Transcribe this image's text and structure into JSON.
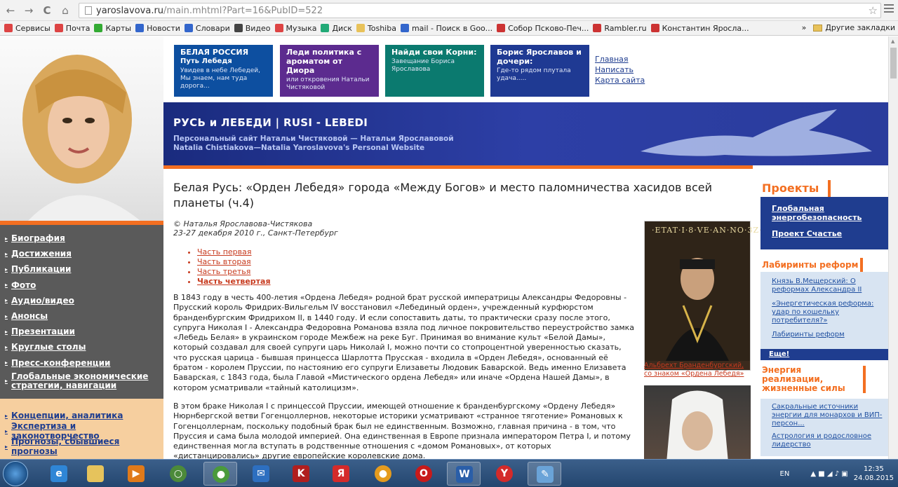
{
  "browser": {
    "back": "←",
    "forward": "→",
    "reload": "C",
    "home": "⌂",
    "url_host": "yaroslavova.ru",
    "url_path": "/main.mhtml?Part=16&PubID=522",
    "star": "☆",
    "bookmarks": [
      {
        "label": "Сервисы",
        "color": "#d44"
      },
      {
        "label": "Почта",
        "color": "#d44"
      },
      {
        "label": "Карты",
        "color": "#3a3"
      },
      {
        "label": "Новости",
        "color": "#36c"
      },
      {
        "label": "Словари",
        "color": "#36c"
      },
      {
        "label": "Видео",
        "color": "#444"
      },
      {
        "label": "Музыка",
        "color": "#d44"
      },
      {
        "label": "Диск",
        "color": "#2a7"
      },
      {
        "label": "Toshiba",
        "color": "#e8c25a"
      },
      {
        "label": "mail - Поиск в Goo...",
        "color": "#36c"
      },
      {
        "label": "Собор Псково-Печ...",
        "color": "#c33"
      },
      {
        "label": "Rambler.ru",
        "color": "#c33"
      },
      {
        "label": "Константин Яросла...",
        "color": "#c33"
      }
    ],
    "bookmarks_more": "»",
    "other_bookmarks": "Другие закладки"
  },
  "left_menu": {
    "items": [
      "Биография",
      "Достижения",
      "Публикации",
      "Фото",
      "Аудио/видео",
      "Анонсы",
      "Презентации",
      "Круглые столы",
      "Пресс-конференции",
      "Глобальные экономические стратегии, навигации"
    ],
    "items2": [
      "Концепции, аналитика",
      "Экспертиза и законотворчество",
      "Прогнозы, сбывшиеся прогнозы"
    ]
  },
  "top_boxes": [
    {
      "title": "БЕЛАЯ РОССИЯ",
      "sub": "Путь Лебедя",
      "text": "Увидев в небе Лебедей, Мы знаем, нам туда дорога..."
    },
    {
      "title": "Леди политика с ароматом от Диора",
      "sub": "",
      "text": "или откровения Натальи Чистяковой"
    },
    {
      "title": "Найди свои Корни:",
      "sub": "",
      "text": "Завещание Бориса Ярославова"
    },
    {
      "title": "Борис Ярославов и дочери:",
      "sub": "",
      "text": "Где-то рядом плутала удача....."
    }
  ],
  "top_links": [
    "Главная",
    "Написать",
    "Карта сайта"
  ],
  "banner": {
    "title": "РУСЬ и ЛЕБЕДИ  |  RUSI - LEBEDI",
    "sub1": "Персональный сайт Натальи Чистяковой — Натальи Ярославовой",
    "sub2": "Natalia Chistiakova—Natalia Yaroslavova's  Personal Website"
  },
  "article": {
    "title": "Белая Русь: «Орден Лебедя» города «Между Богов» и место паломничества хасидов всей планеты (ч.4)",
    "author": "© Наталья Ярославова-Чистякова",
    "date": "23-27 декабря 2010 г., Санкт-Петербург",
    "parts": [
      "Часть первая",
      "Часть вторая",
      "Часть третья",
      "Часть четвертая"
    ],
    "p1": "В 1843 году в честь 400-летия «Ордена Лебедя» родной брат русской императрицы Александры Федоровны - Прусский король Фридрих-Вильгельм IV восстановил «Лебединый орден», учрежденный курфюрстом бранденбургским Фридрихом II, в 1440 году. И если сопоставить даты, то практически сразу после этого, супруга Николая I - Александра Федоровна Романова взяла под личное покровительство переустройство замка «Лебедь Белая» в украинском городе Межбеж на реке Буг. Принимая во внимание культ «Белой Дамы», который создавал для своей супруги царь Николай I, можно почти со стопроцентной уверенностью сказать, что русская царица - бывшая принцесса Шарлотта Прусская - входила в «Орден Лебедя», основанный её братом - королем Пруссии, по настоянию его супруги Елизаветы Людовик Баварской. Ведь именно Елизавета Баварская, с 1843 года, была Главой «Мистического ордена Лебедя» или иначе «Ордена Нашей Дамы», в котором усматривали «тайный католицизм».",
    "p2": "В этом браке Николая I с принцессой Пруссии, имеющей отношение к бранденбургскому «Ордену Лебедя» Нюрнбергской ветви Гогенцоллернов, некоторые историки усматривают «странное тяготение» Романовых к Гогенцоллернам, поскольку подобный брак был не единственным. Возможно, главная причина - в том, что Пруссия и сама была молодой империей. Она единственная в Европе признала императором Петра I, и потому единственная могла вступать в родственные отношения с «домом Романовых», от которых «дистанцировались» другие европейские королевские дома.",
    "fig1_text": "·ETAT·I·8·VE·AN·NO·3Z·I·Y·ZZ·",
    "fig1_caption": "Альбрехт Бранденбургский, со знаком «Ордена Лебедя»"
  },
  "right": {
    "projects_title": "Проекты",
    "projects": [
      "Глобальная энергобезопасность",
      "Проект Счастье"
    ],
    "lab_title": "Лабиринты реформ",
    "lab_links": [
      "Князь В.Мещерский: О реформах Александра II",
      "«Энергетическая реформа: удар по кошельку потребителя?»",
      "Лабиринты реформ"
    ],
    "more": "Еще!",
    "energy_title": "Энергия реализации, жизненные силы",
    "energy_links": [
      "Сакральные источники энергии для монархов и ВИП-персон...",
      "Астрология и родословное лидерство"
    ]
  },
  "taskbar": {
    "lang": "EN",
    "time": "12:35",
    "date": "24.08.2015"
  },
  "colors": {
    "accent": "#f36f21",
    "brand_blue": "#1f3d8f",
    "menu_gray": "#5a5a5a"
  }
}
